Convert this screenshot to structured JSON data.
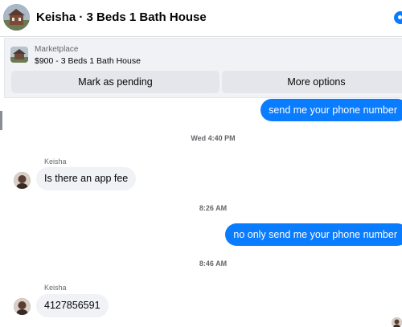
{
  "header": {
    "title": "Keisha · 3 Beds 1 Bath House",
    "avatar_icon": "house-photo-avatar",
    "status_icon": "blue-dot-icon"
  },
  "listing": {
    "source": "Marketplace",
    "description": "$900 - 3 Beds 1 Bath House",
    "thumb_icon": "house-photo-thumbnail",
    "mark_pending_label": "Mark as pending",
    "more_options_label": "More options"
  },
  "messages": {
    "m1_text": "send me your phone number",
    "t1": "Wed 4:40 PM",
    "sender1": "Keisha",
    "m2_text": "Is there an app fee",
    "t2": "8:26 AM",
    "m3_text": "no only send me your phone number",
    "t3": "8:46 AM",
    "sender2": "Keisha",
    "m4_text": "4127856591"
  },
  "colors": {
    "outgoing_bubble": "#0a7cff",
    "incoming_bubble": "#f0f2f5",
    "button_bg": "#e4e6eb",
    "muted_text": "#65676b"
  }
}
